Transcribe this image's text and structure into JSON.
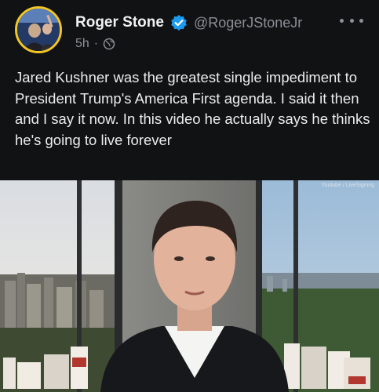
{
  "tweet": {
    "display_name": "Roger Stone",
    "handle": "@RogerJStoneJr",
    "time": "5h",
    "separator": "·",
    "text": "Jared Kushner was the greatest single impediment to President Trump's America First agenda. I said it then and I say it now. In this video he actually says he thinks he's going to live forever"
  },
  "media": {
    "watermark": "Youtube / LiveSigning"
  },
  "icons": {
    "verified": "verified-badge-icon",
    "audience": "globe-icon",
    "more": "more-options-icon"
  },
  "colors": {
    "background": "#111214",
    "verified_blue": "#1d9bf0",
    "avatar_ring": "#f3c623",
    "muted_text": "#8d8f96"
  }
}
